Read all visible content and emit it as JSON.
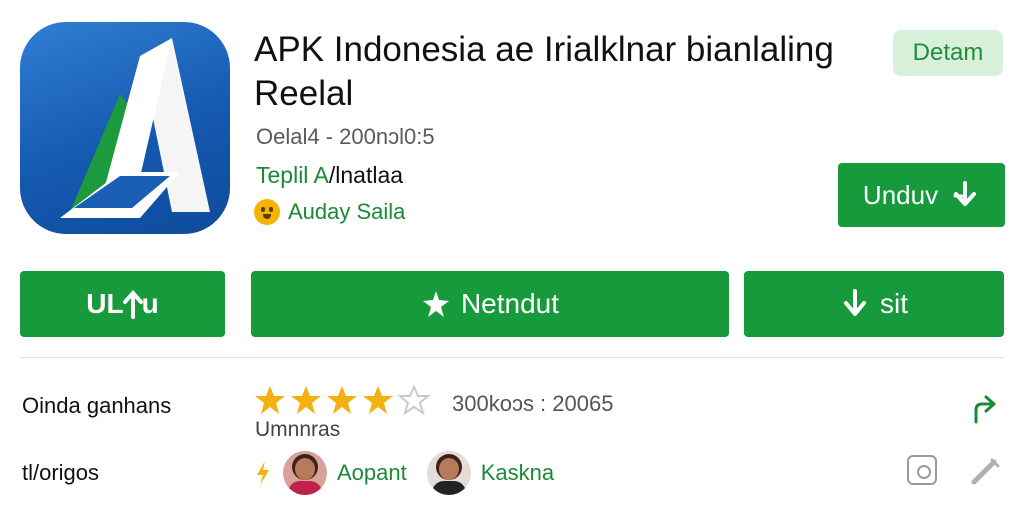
{
  "header": {
    "title_line1": "APK Indonesia ae  Irialklnar bianlaling",
    "title_line2": "Reelal",
    "detail_button": "Detam",
    "version": "Oelal4 - 200nɔl0:5",
    "category_green": "Teplil A",
    "category_dark": "/l",
    "category_rest": "natlaa",
    "developer": "Auday Saila",
    "download_button": "Unduv"
  },
  "actions": {
    "left_button": "UL",
    "left_button_suffix": "u",
    "middle_button": "Netndut",
    "right_button": "sit"
  },
  "info": {
    "row1_label": "Oinda",
    "row1_label_rest": "ganhans",
    "stars_filled": 4,
    "stars_total": 5,
    "reviews": "300koɔs : 20065",
    "sub_label": "Umnnras",
    "row2_label": "tl/origos",
    "person1": "Aopant",
    "person2": "Kaskna"
  },
  "colors": {
    "primary_green": "#169a3c",
    "badge_bg": "#d7f0d9",
    "star_gold": "#f2b10f",
    "icon_blue": "#1559b0"
  }
}
